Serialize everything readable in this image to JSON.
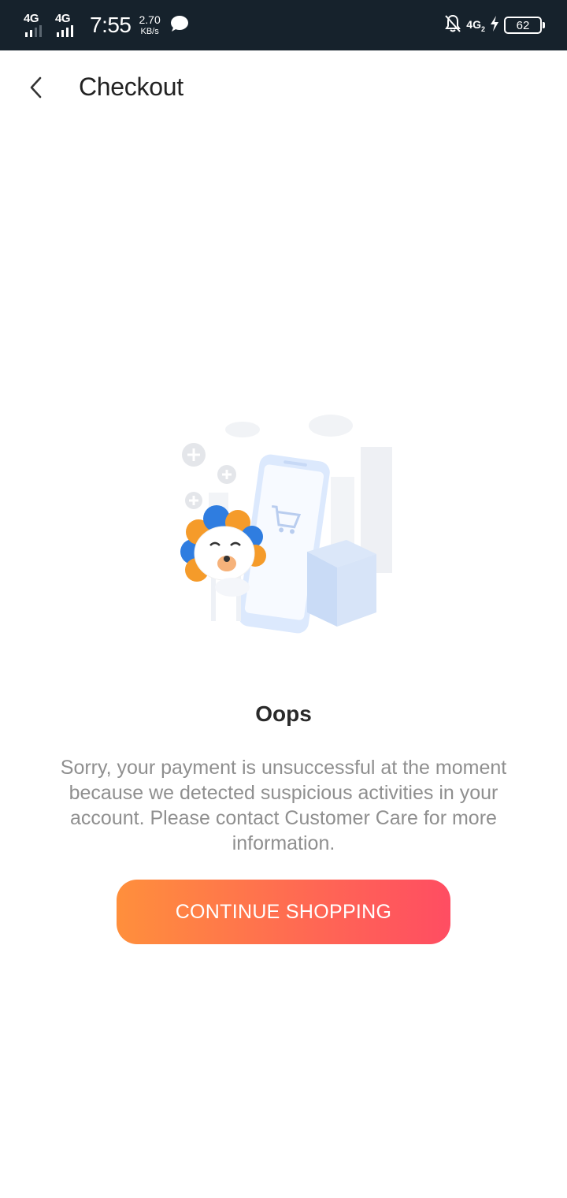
{
  "status_bar": {
    "network1": "4G",
    "network2": "4G",
    "time": "7:55",
    "speed_value": "2.70",
    "speed_unit": "KB/s",
    "network_right": "4G",
    "network_right_sub": "2",
    "battery_level": "62",
    "icons": [
      "signal-icon",
      "chat-bubble-icon",
      "notifications-off-icon",
      "charging-bolt-icon",
      "battery-icon"
    ]
  },
  "header": {
    "title": "Checkout",
    "back_icon": "chevron-left-icon"
  },
  "content": {
    "illustration": "lion-mascot-shopping-illustration",
    "title": "Oops",
    "message": "Sorry, your payment is unsuccessful at the moment because we detected suspicious activities in your account. Please contact Customer Care for more information.",
    "button_label": "CONTINUE SHOPPING"
  },
  "colors": {
    "status_bar_bg": "#16222c",
    "button_gradient_start": "#ff8f3c",
    "button_gradient_end": "#ff4d62",
    "message_text": "#8f8f8f",
    "title_text": "#222222"
  }
}
